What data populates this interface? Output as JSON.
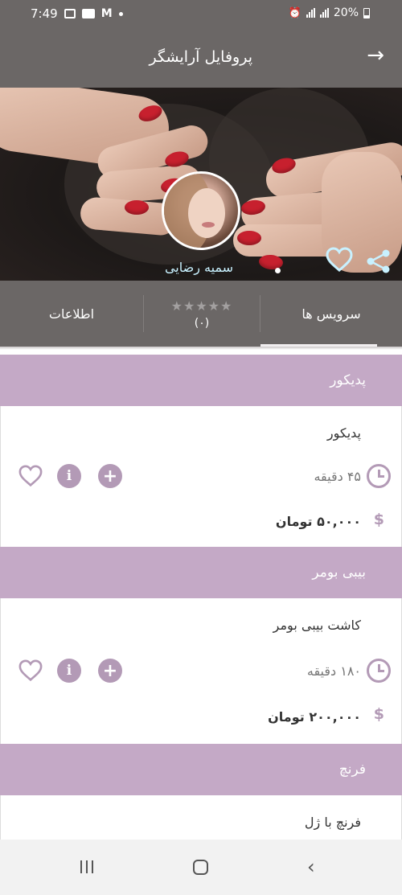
{
  "status_bar": {
    "time": "7:49",
    "battery": "20%"
  },
  "app_bar": {
    "title": "پروفایل آرایشگر"
  },
  "profile": {
    "name": "سمیه رضایی"
  },
  "tabs": {
    "services": "سرویس ها",
    "rating_stars": "★★★★★",
    "rating_count": "(۰)",
    "info": "اطلاعات",
    "active": "services"
  },
  "categories": [
    {
      "title": "پدیکور",
      "service_name": "پدیکور",
      "duration": "۴۵ دقیقه",
      "price": "۵۰,۰۰۰ تومان"
    },
    {
      "title": "بیبی بومر",
      "service_name": "کاشت بیبی بومر",
      "duration": "۱۸۰ دقیقه",
      "price": "۲۰۰,۰۰۰ تومان"
    },
    {
      "title": "فرنچ",
      "service_name": "فرنچ با ژل",
      "duration": "",
      "price": ""
    }
  ],
  "icons": {
    "dollar": "$",
    "info": "i",
    "add": "+",
    "back": "→"
  },
  "colors": {
    "bar": "#6b6766",
    "category_header": "#c4a9c6",
    "accent": "#b39ab6",
    "name_text": "#c8f1ff"
  }
}
